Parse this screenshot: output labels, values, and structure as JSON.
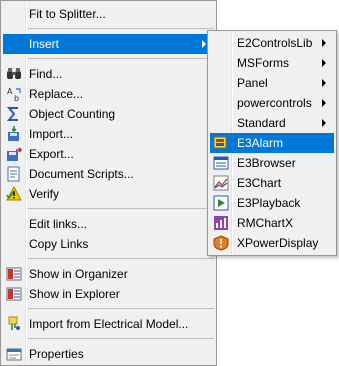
{
  "menu": {
    "fit_to_splitter": "Fit to Splitter...",
    "insert": "Insert",
    "find": "Find...",
    "replace": "Replace...",
    "object_counting": "Object Counting",
    "import": "Import...",
    "export": "Export...",
    "document_scripts": "Document Scripts...",
    "verify": "Verify",
    "edit_links": "Edit links...",
    "copy_links": "Copy Links",
    "show_in_organizer": "Show in Organizer",
    "show_in_explorer": "Show in Explorer",
    "import_from_electrical_model": "Import from Electrical Model...",
    "properties": "Properties"
  },
  "submenu": {
    "e2controlslib": "E2ControlsLib",
    "msforms": "MSForms",
    "panel": "Panel",
    "powercontrols": "powercontrols",
    "standard": "Standard",
    "e3alarm": "E3Alarm",
    "e3browser": "E3Browser",
    "e3chart": "E3Chart",
    "e3playback": "E3Playback",
    "rmchartx": "RMChartX",
    "xpowerdisplay": "XPowerDisplay"
  },
  "colors": {
    "highlight": "#0078d7",
    "menu_bg": "#f0f0f0"
  }
}
